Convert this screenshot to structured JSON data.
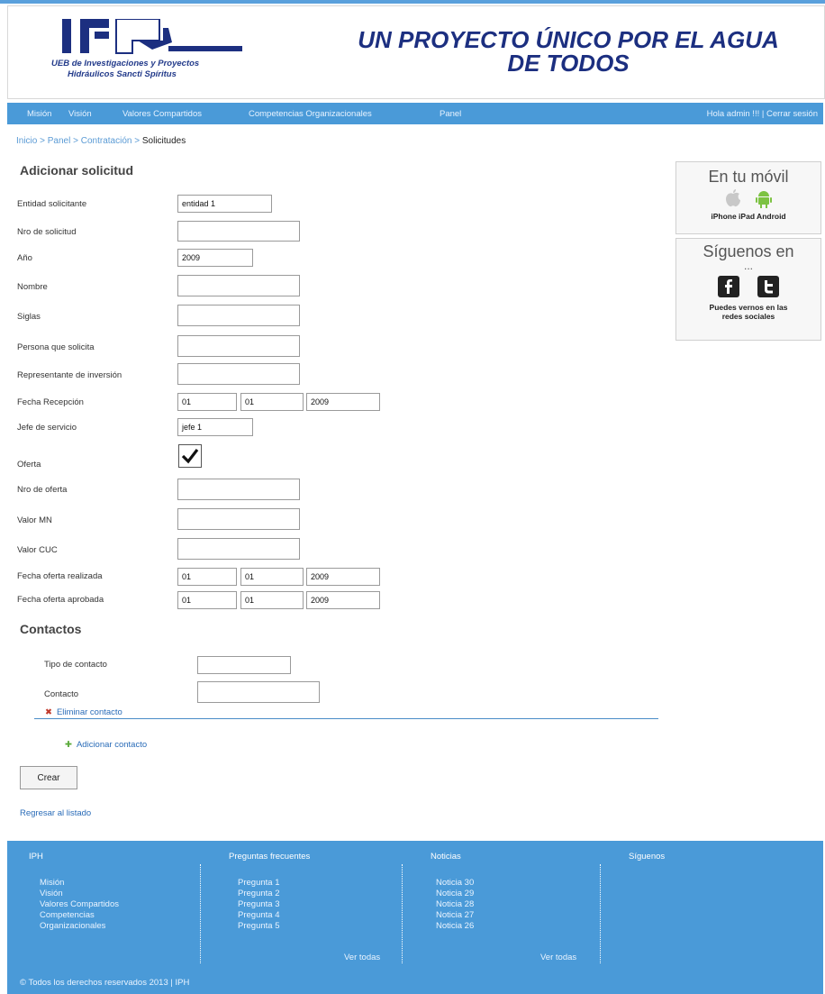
{
  "header": {
    "logo_text": "IPH",
    "logo_subtitle_line1": "UEB de Investigaciones y Proyectos",
    "logo_subtitle_line2": "Hidráulicos Sancti Spíritus",
    "slogan_line1": "UN PROYECTO ÚNICO POR EL AGUA",
    "slogan_line2": "DE TODOS"
  },
  "nav": {
    "items": [
      "Misión",
      "Visión",
      "Valores Compartidos",
      "Competencias Organizacionales",
      "Panel"
    ],
    "greeting": "Hola admin !!! |",
    "logout": "Cerrar sesión"
  },
  "breadcrumb": {
    "links": [
      "Inicio",
      "Panel",
      "Contratación"
    ],
    "separator": ">",
    "current": "Solicitudes"
  },
  "form": {
    "title": "Adicionar solicitud",
    "labels": {
      "entidad": "Entidad solicitante",
      "nro_solicitud": "Nro de solicitud",
      "anio": "Año",
      "nombre": "Nombre",
      "siglas": "Siglas",
      "persona": "Persona que solicita",
      "representante": "Representante de inversión",
      "fecha_recepcion": "Fecha Recepción",
      "jefe": "Jefe de servicio",
      "oferta": "Oferta",
      "nro_oferta": "Nro de oferta",
      "valor_mn": "Valor MN",
      "valor_cuc": "Valor CUC",
      "fecha_realizada": "Fecha oferta realizada",
      "fecha_aprobada": "Fecha oferta aprobada"
    },
    "values": {
      "entidad": "entidad 1",
      "nro_solicitud": "",
      "anio": "2009",
      "nombre": "",
      "siglas": "",
      "persona": "",
      "representante": "",
      "fecha_recepcion": {
        "day": "01",
        "month": "01",
        "year": "2009"
      },
      "jefe": "jefe 1",
      "oferta_checked": true,
      "nro_oferta": "",
      "valor_mn": "",
      "valor_cuc": "",
      "fecha_realizada": {
        "day": "01",
        "month": "01",
        "year": "2009"
      },
      "fecha_aprobada": {
        "day": "01",
        "month": "01",
        "year": "2009"
      }
    }
  },
  "contacts": {
    "title": "Contactos",
    "tipo_label": "Tipo de contacto",
    "tipo_value": "",
    "contacto_label": "Contacto",
    "contacto_value": "",
    "remove_icon": "✖",
    "remove_label": "Eliminar contacto",
    "add_icon": "✚",
    "add_label": "Adicionar contacto"
  },
  "actions": {
    "create": "Crear",
    "back": "Regresar al listado"
  },
  "sidebar": {
    "mobile": {
      "title": "En tu móvil",
      "desc": "iPhone iPad Android"
    },
    "social": {
      "title": "Síguenos en",
      "title_cont": "...",
      "desc_line1": "Puedes vernos en las",
      "desc_line2": "redes sociales"
    }
  },
  "footer": {
    "columns": [
      {
        "title": "IPH",
        "items": [
          "Misión",
          "Visión",
          "Valores Compartidos",
          "Competencias",
          "Organizacionales"
        ],
        "more": ""
      },
      {
        "title": "Preguntas frecuentes",
        "items": [
          "Pregunta 1",
          "Pregunta 2",
          "Pregunta 3",
          "Pregunta 4",
          "Pregunta 5"
        ],
        "more": "Ver todas"
      },
      {
        "title": "Noticias",
        "items": [
          "Noticia 30",
          "Noticia 29",
          "Noticia 28",
          "Noticia 27",
          "Noticia 26"
        ],
        "more": "Ver todas"
      },
      {
        "title": "Síguenos",
        "items": [],
        "more": ""
      }
    ],
    "copyright": "© Todos los derechos reservados 2013 | IPH"
  },
  "colors": {
    "brand_blue": "#4a9ad8",
    "logo_navy": "#1c2f80",
    "link": "#2a6cb8"
  }
}
